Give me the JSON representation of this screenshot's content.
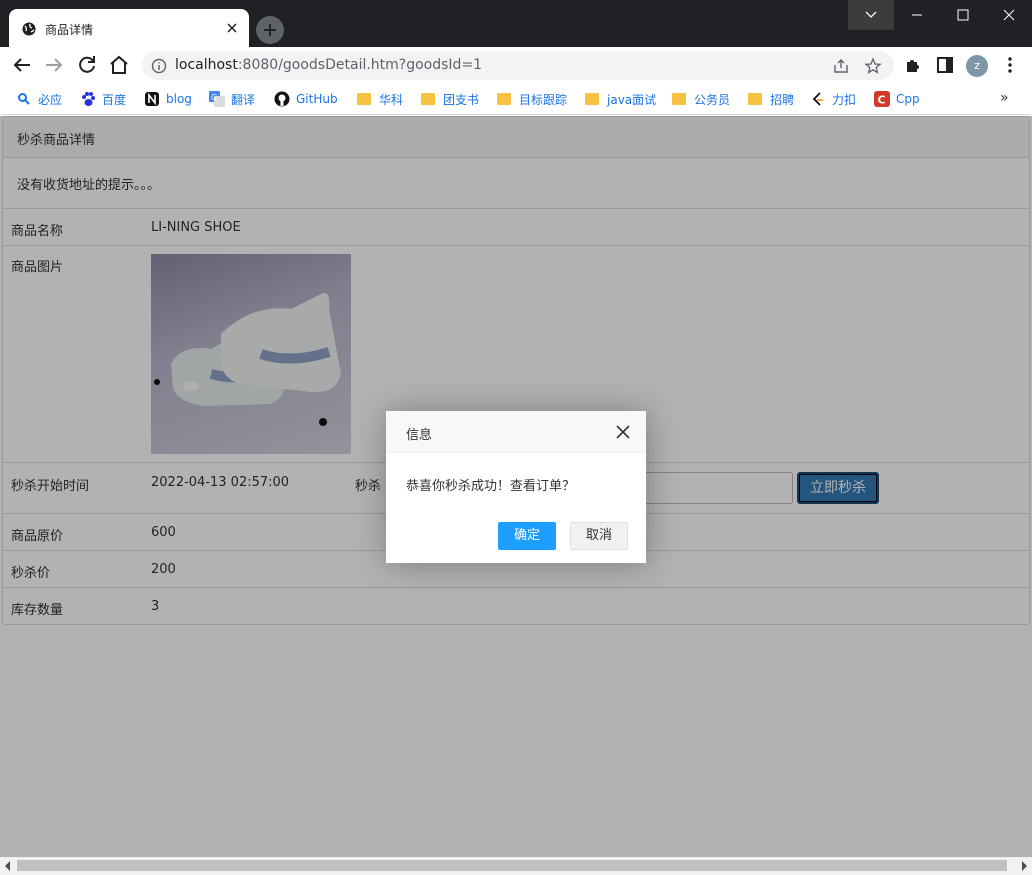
{
  "browser": {
    "tab_title": "商品详情",
    "url_host": "localhost",
    "url_rest": ":8080/goodsDetail.htm?goodsId=1",
    "avatar_letter": "z",
    "bookmarks": [
      {
        "label": "必应",
        "icon": "search-icon"
      },
      {
        "label": "百度",
        "icon": "baidu-icon"
      },
      {
        "label": "blog",
        "icon": "notion-icon"
      },
      {
        "label": "翻译",
        "icon": "translate-icon"
      },
      {
        "label": "GitHub",
        "icon": "github-icon"
      },
      {
        "label": "华科",
        "icon": "folder-icon"
      },
      {
        "label": "团支书",
        "icon": "folder-icon"
      },
      {
        "label": "目标跟踪",
        "icon": "folder-icon"
      },
      {
        "label": "java面试",
        "icon": "folder-icon"
      },
      {
        "label": "公务员",
        "icon": "folder-icon"
      },
      {
        "label": "招聘",
        "icon": "folder-icon"
      },
      {
        "label": "力扣",
        "icon": "leetcode-icon"
      },
      {
        "label": "Cpp",
        "icon": "cpp-icon"
      }
    ],
    "more_bookmarks": "»"
  },
  "page": {
    "heading": "秒杀商品详情",
    "notice": "没有收货地址的提示。。。",
    "rows": {
      "name_label": "商品名称",
      "name_value": "LI-NING SHOE",
      "image_label": "商品图片",
      "start_label": "秒杀开始时间",
      "start_value": "2022-04-13 02:57:00",
      "countdown_label": "秒杀",
      "buy_button": "立即秒杀",
      "price_label": "商品原价",
      "price_value": "600",
      "sale_label": "秒杀价",
      "sale_value": "200",
      "stock_label": "库存数量",
      "stock_value": "3"
    }
  },
  "dialog": {
    "title": "信息",
    "message": "恭喜你秒杀成功！查看订单？",
    "ok": "确定",
    "cancel": "取消"
  },
  "colors": {
    "accent": "#1e9fff",
    "buy_button": "#337ab7"
  }
}
